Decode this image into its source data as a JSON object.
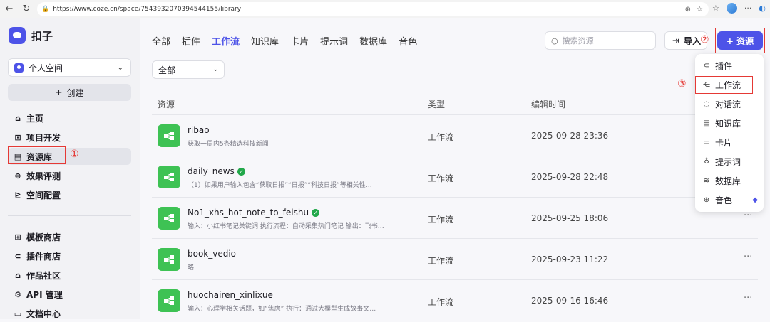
{
  "browser": {
    "url": "https://www.coze.cn/space/7543932070394544155/library"
  },
  "app": {
    "name": "扣子"
  },
  "sidebar": {
    "space_label": "个人空间",
    "create_label": "创建",
    "items": [
      {
        "label": "主页",
        "icon": "home-icon"
      },
      {
        "label": "项目开发",
        "icon": "project-icon"
      },
      {
        "label": "资源库",
        "icon": "library-icon"
      },
      {
        "label": "效果评测",
        "icon": "evaluate-icon"
      },
      {
        "label": "空间配置",
        "icon": "config-icon"
      },
      {
        "label": "模板商店",
        "icon": "template-icon"
      },
      {
        "label": "插件商店",
        "icon": "plugin-icon"
      },
      {
        "label": "作品社区",
        "icon": "community-icon"
      },
      {
        "label": "API 管理",
        "icon": "api-icon"
      },
      {
        "label": "文档中心",
        "icon": "docs-icon"
      }
    ]
  },
  "tabs": [
    "全部",
    "插件",
    "工作流",
    "知识库",
    "卡片",
    "提示词",
    "数据库",
    "音色"
  ],
  "active_tab": "工作流",
  "search": {
    "placeholder": "搜索资源"
  },
  "import_label": "导入",
  "resource_button": "+ 资源",
  "filter": {
    "value": "全部"
  },
  "table": {
    "headers": [
      "资源",
      "类型",
      "编辑时间"
    ],
    "rows": [
      {
        "name": "ribao",
        "desc": "获取一周内5条精选科技新闻",
        "type": "工作流",
        "time": "2025-09-28 23:36",
        "verified": false
      },
      {
        "name": "daily_news",
        "desc": "（1）如果用户输入包含“获取日报”“日报”“科技日报”等相关性…",
        "type": "工作流",
        "time": "2025-09-28 22:48",
        "verified": true
      },
      {
        "name": "No1_xhs_hot_note_to_feishu",
        "desc": "输入：小红书笔记关键词 执行流程：自动采集热门笔记 输出：飞书…",
        "type": "工作流",
        "time": "2025-09-25 18:06",
        "verified": true
      },
      {
        "name": "book_vedio",
        "desc": "略",
        "type": "工作流",
        "time": "2025-09-23 11:22",
        "verified": false
      },
      {
        "name": "huochairen_xinlixue",
        "desc": "输入：心理学相关话题，如“焦虑” 执行：通过大模型生成故事文…",
        "type": "工作流",
        "time": "2025-09-16 16:46",
        "verified": false
      }
    ]
  },
  "dropdown": {
    "items": [
      "插件",
      "工作流",
      "对话流",
      "知识库",
      "卡片",
      "提示词",
      "数据库",
      "音色"
    ]
  },
  "annotations": [
    "①",
    "②",
    "③"
  ],
  "colors": {
    "accent": "#4d53e8",
    "workflow_green": "#3ec254",
    "annotation_red": "#e53935"
  }
}
